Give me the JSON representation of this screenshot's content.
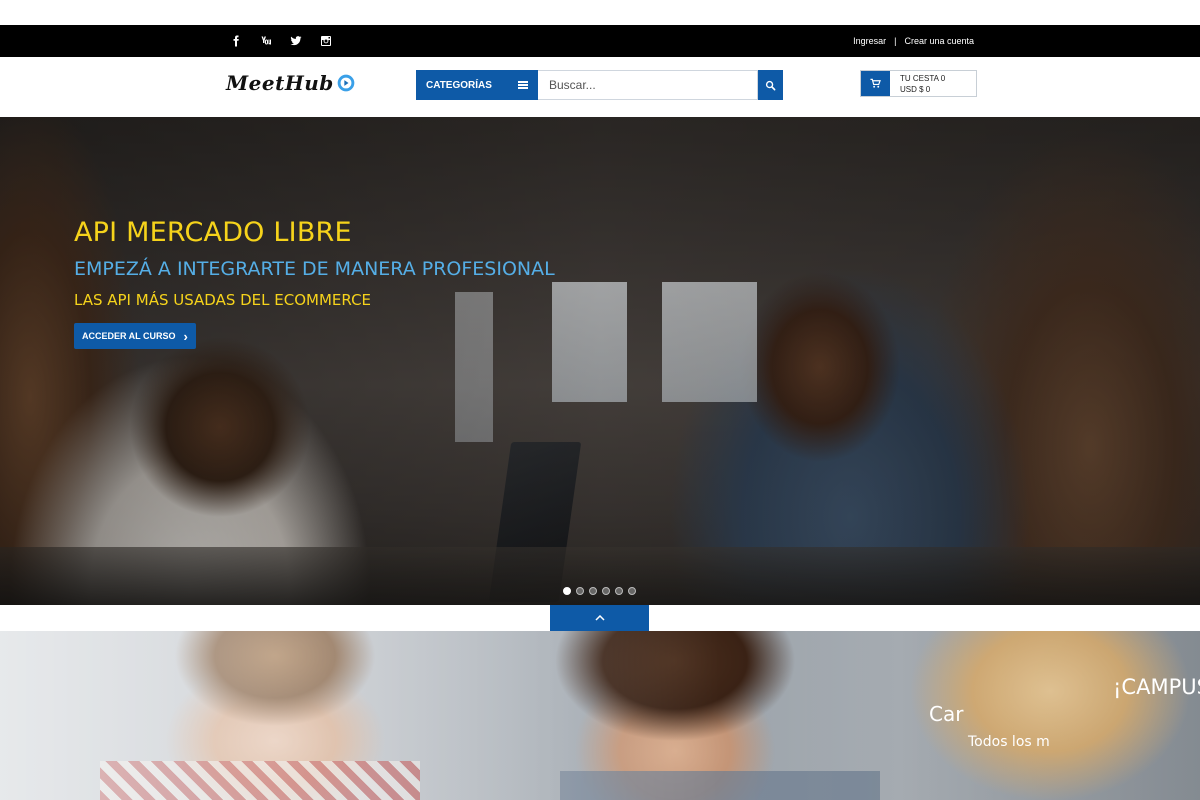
{
  "topbar": {
    "social": [
      {
        "name": "facebook-icon"
      },
      {
        "name": "youtube-icon"
      },
      {
        "name": "twitter-icon"
      },
      {
        "name": "instagram-icon"
      }
    ],
    "login": "Ingresar",
    "separator": "|",
    "register": "Crear una cuenta"
  },
  "header": {
    "logo_text": "MeetHub",
    "categories_label": "CATEGORÍAS",
    "search_placeholder": "Buscar...",
    "cart_line1": "TU CESTA 0",
    "cart_line2": "USD $ 0"
  },
  "hero": {
    "title": "API MERCADO LIBRE",
    "subtitle": "EMPEZÁ A INTEGRARTE DE MANERA PROFESIONAL",
    "tagline": "LAS API MÁS USADAS DEL ECOMMERCE",
    "cta": "ACCEDER AL CURSO",
    "slides_total": 6,
    "active_slide": 1
  },
  "campus": {
    "title": "¡CAMPUS VIRTUAL DE CA",
    "subtitle": "Car",
    "small": "Todos los m"
  },
  "colors": {
    "accent": "#0e5aa7",
    "hero_yellow": "#f6d31b",
    "hero_blue": "#55aee6",
    "topbar": "#000000"
  }
}
